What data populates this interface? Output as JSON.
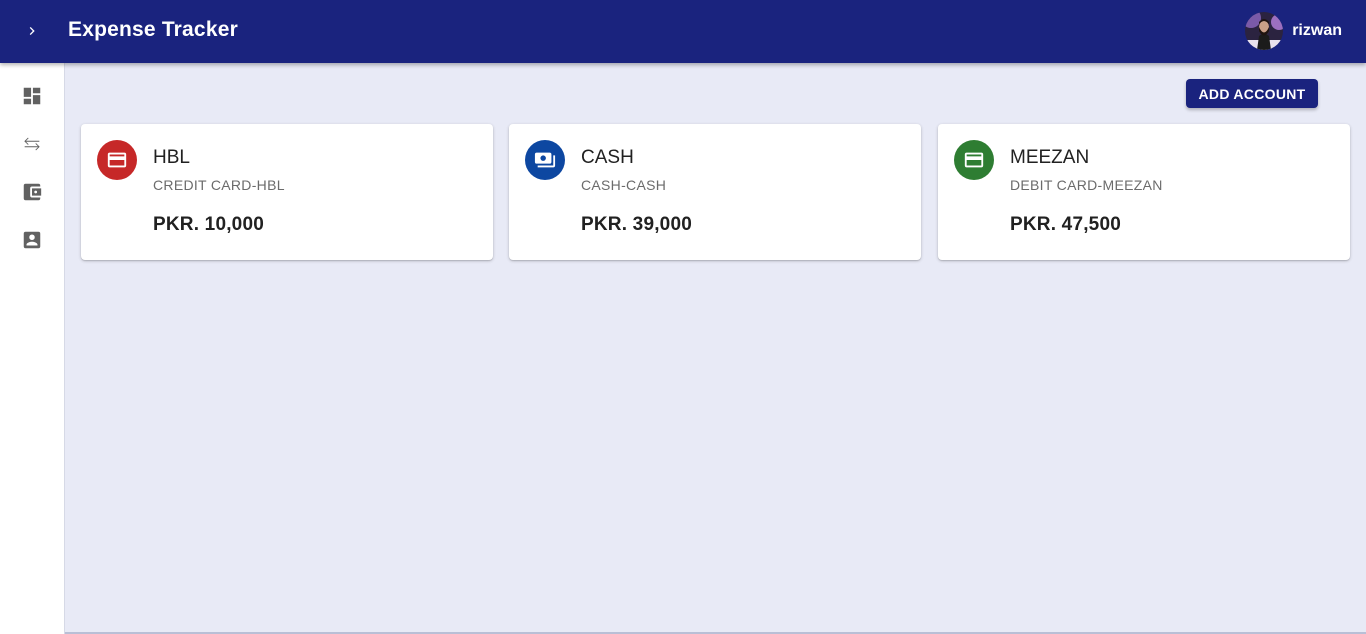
{
  "app": {
    "title": "Expense Tracker",
    "user_name": "rizwan",
    "menu_toggle_icon": "chevron-right-icon",
    "avatar": "user-avatar"
  },
  "sidebar": {
    "items": [
      {
        "name": "dashboard",
        "icon": "dashboard-icon"
      },
      {
        "name": "transactions",
        "icon": "swap-arrows-icon"
      },
      {
        "name": "accounts",
        "icon": "wallet-icon"
      },
      {
        "name": "profile",
        "icon": "account-box-icon"
      }
    ]
  },
  "actions": {
    "add_account_label": "ADD ACCOUNT"
  },
  "accounts": [
    {
      "name": "HBL",
      "type": "CREDIT CARD-HBL",
      "balance": "PKR. 10,000",
      "icon": "credit-card-icon",
      "color": "#c62828"
    },
    {
      "name": "CASH",
      "type": "CASH-CASH",
      "balance": "PKR. 39,000",
      "icon": "cash-icon",
      "color": "#0d47a1"
    },
    {
      "name": "MEEZAN",
      "type": "DEBIT CARD-MEEZAN",
      "balance": "PKR. 47,500",
      "icon": "credit-card-icon",
      "color": "#2e7d32"
    }
  ],
  "colors": {
    "appbar": "#1a237e",
    "background": "#e8eaf6"
  }
}
